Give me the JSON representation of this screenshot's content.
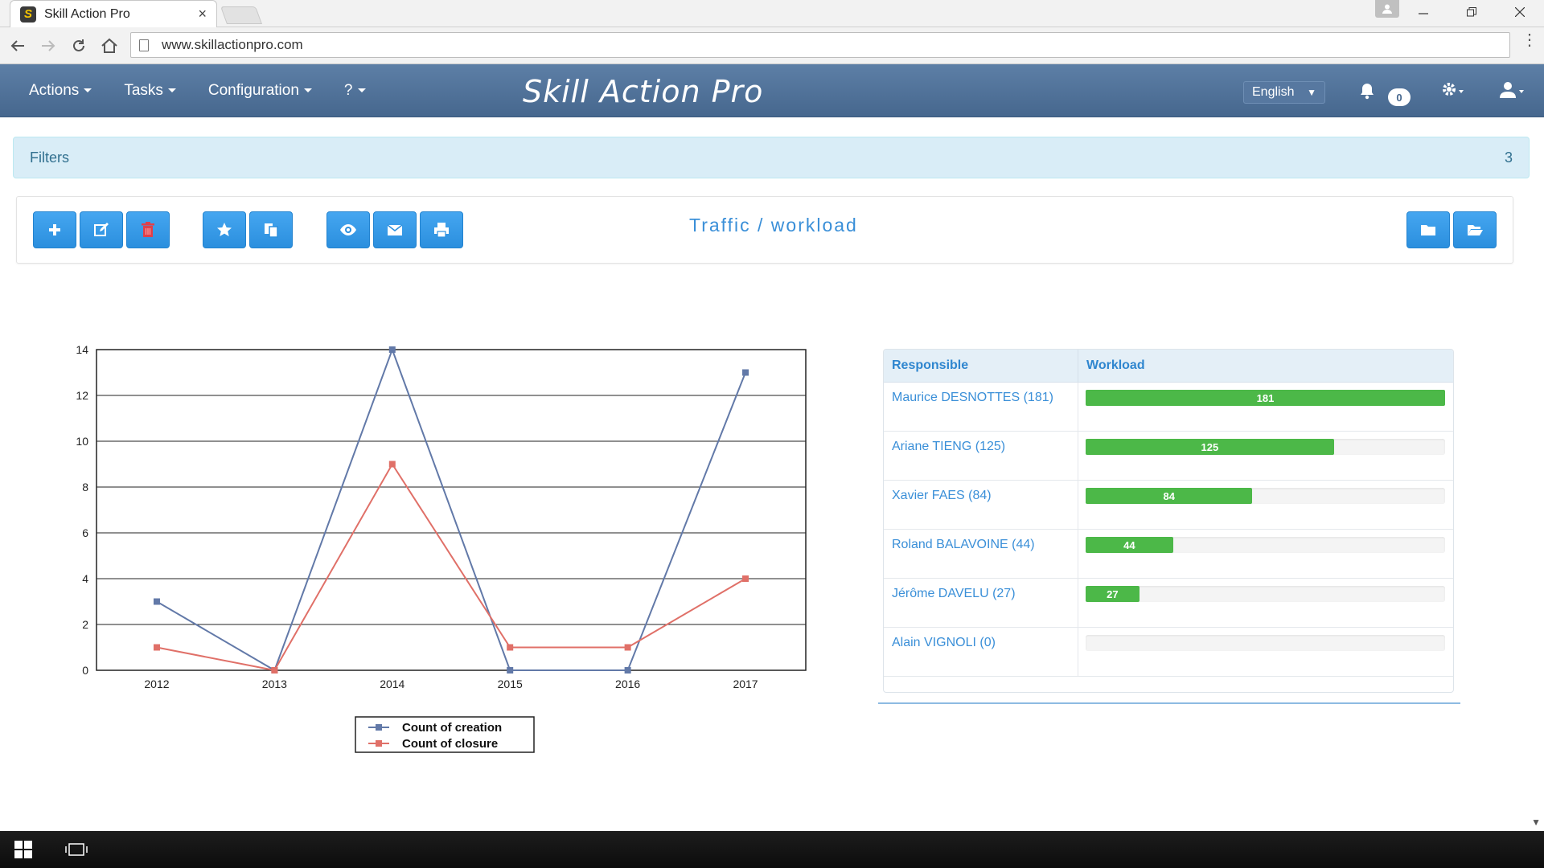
{
  "browser": {
    "tab_title": "Skill Action Pro",
    "favicon_letter": "S",
    "tab_close": "×",
    "url": "www.skillactionpro.com"
  },
  "navbar": {
    "menu": [
      {
        "label": "Actions"
      },
      {
        "label": "Tasks"
      },
      {
        "label": "Configuration"
      },
      {
        "label": "?"
      }
    ],
    "brand": "Skill Action Pro",
    "language": "English",
    "notification_count": "0",
    "icons": {
      "bell": "bell-icon",
      "settings": "gear-icon",
      "user": "user-icon"
    }
  },
  "filters": {
    "label": "Filters",
    "count": "3"
  },
  "toolbar": {
    "title": "Traffic / workload",
    "buttons": [
      "plus-icon",
      "edit-icon",
      "trash-icon",
      "star-icon",
      "copy-icon",
      "eye-icon",
      "envelope-icon",
      "print-icon",
      "folder-icon",
      "folder-open-icon"
    ]
  },
  "chart_data": {
    "type": "line",
    "x": [
      "2012",
      "2013",
      "2014",
      "2015",
      "2016",
      "2017"
    ],
    "series": [
      {
        "name": "Count of creation",
        "values": [
          3,
          0,
          14,
          0,
          0,
          13
        ],
        "color": "#6279a8"
      },
      {
        "name": "Count of closure",
        "values": [
          1,
          0,
          9,
          1,
          1,
          4
        ],
        "color": "#e07068"
      }
    ],
    "ylim": [
      0,
      14
    ],
    "yticks": [
      0,
      2,
      4,
      6,
      8,
      10,
      12,
      14
    ],
    "grid": true,
    "legend": "bottom"
  },
  "workload": {
    "headers": {
      "responsible": "Responsible",
      "workload": "Workload"
    },
    "max": 181,
    "rows": [
      {
        "name": "Maurice DESNOTTES (181)",
        "value": 181,
        "label": "181"
      },
      {
        "name": "Ariane TIENG (125)",
        "value": 125,
        "label": "125"
      },
      {
        "name": "Xavier FAES (84)",
        "value": 84,
        "label": "84"
      },
      {
        "name": "Roland BALAVOINE (44)",
        "value": 44,
        "label": "44"
      },
      {
        "name": "Jérôme DAVELU (27)",
        "value": 27,
        "label": "27"
      },
      {
        "name": "Alain VIGNOLI (0)",
        "value": 0,
        "label": ""
      }
    ],
    "bar_color": "#4cb848"
  }
}
